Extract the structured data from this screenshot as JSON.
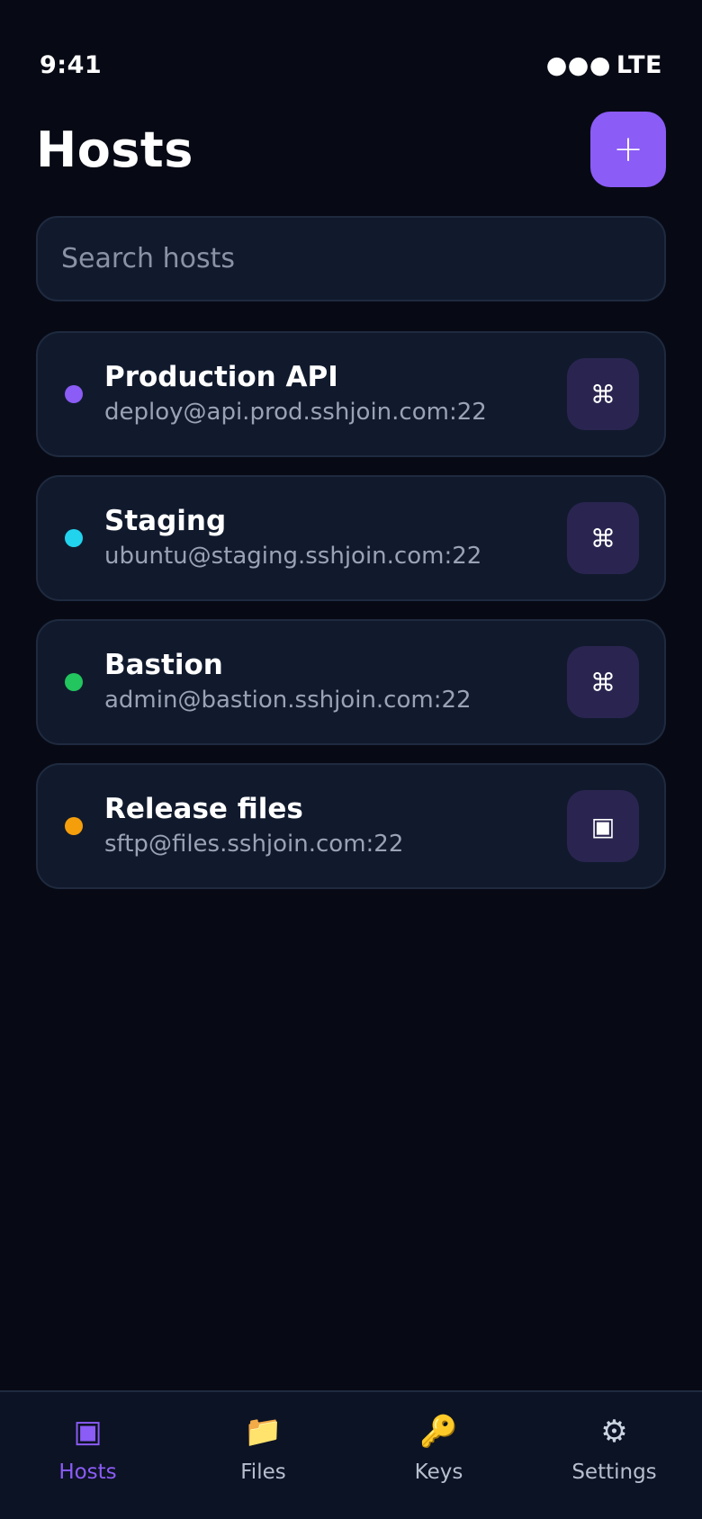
{
  "status_bar": {
    "time": "9:41",
    "signal": "●●●",
    "network": "LTE"
  },
  "header": {
    "title": "Hosts",
    "add_label": "+"
  },
  "search": {
    "placeholder": "Search hosts",
    "value": ""
  },
  "hosts": [
    {
      "name": "Production API",
      "address": "deploy@api.prod.sshjoin.com:22",
      "status_color": "#8b5cf6",
      "action_icon": "⌘",
      "action_icon_name": "command-icon"
    },
    {
      "name": "Staging",
      "address": "ubuntu@staging.sshjoin.com:22",
      "status_color": "#22d3ee",
      "action_icon": "⌘",
      "action_icon_name": "command-icon"
    },
    {
      "name": "Bastion",
      "address": "admin@bastion.sshjoin.com:22",
      "status_color": "#22c55e",
      "action_icon": "⌘",
      "action_icon_name": "command-icon"
    },
    {
      "name": "Release files",
      "address": "sftp@files.sshjoin.com:22",
      "status_color": "#f59e0b",
      "action_icon": "▣",
      "action_icon_name": "square-icon"
    }
  ],
  "tabs": [
    {
      "label": "Hosts",
      "icon": "▣",
      "icon_name": "hosts-icon",
      "active": true
    },
    {
      "label": "Files",
      "icon": "📁",
      "icon_name": "folder-icon",
      "active": false
    },
    {
      "label": "Keys",
      "icon": "🔑",
      "icon_name": "key-icon",
      "active": false
    },
    {
      "label": "Settings",
      "icon": "⚙",
      "icon_name": "gear-icon",
      "active": false
    }
  ],
  "colors": {
    "accent": "#8b5cf6",
    "background": "#070a15",
    "card": "#111a2d"
  }
}
